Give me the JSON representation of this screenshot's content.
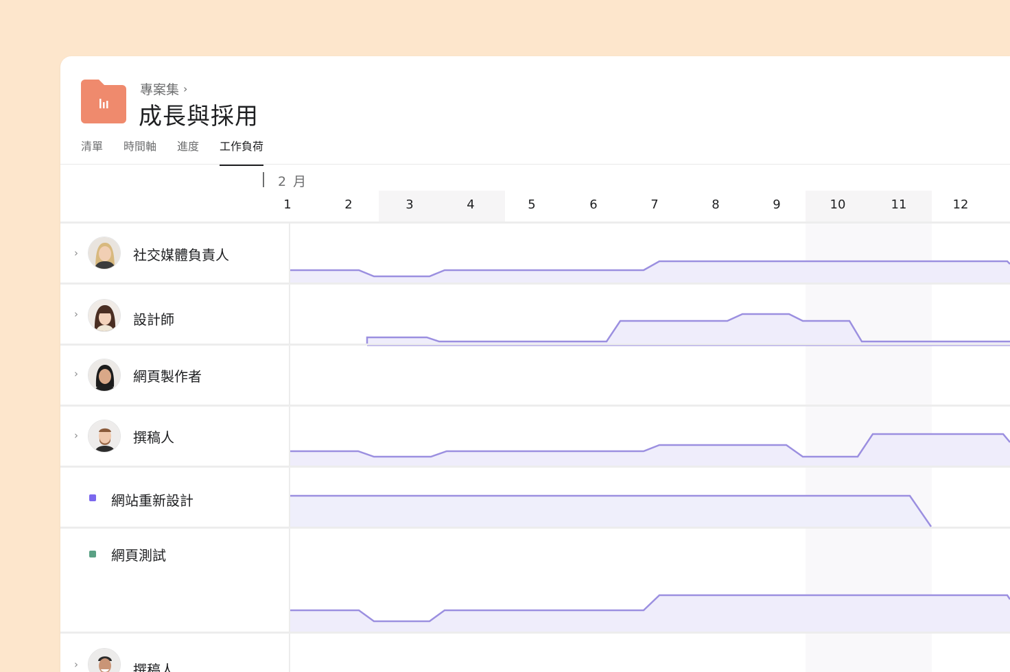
{
  "breadcrumb": {
    "label": "專案集"
  },
  "title": "成長與採用",
  "tabs": [
    {
      "label": "清單",
      "active": false
    },
    {
      "label": "時間軸",
      "active": false
    },
    {
      "label": "進度",
      "active": false
    },
    {
      "label": "工作負荷",
      "active": true
    }
  ],
  "timeline": {
    "month": "2 月",
    "days": [
      "1",
      "2",
      "3",
      "4",
      "5",
      "6",
      "7",
      "8",
      "9",
      "10",
      "11",
      "12"
    ]
  },
  "rows": [
    {
      "type": "person",
      "label": "社交媒體負責人",
      "avatar_icon": "woman-blonde-avatar"
    },
    {
      "type": "person",
      "label": "設計師",
      "avatar_icon": "woman-bangs-avatar"
    },
    {
      "type": "person",
      "label": "網頁製作者",
      "avatar_icon": "woman-dark-hair-avatar"
    },
    {
      "type": "person",
      "label": "撰稿人",
      "avatar_icon": "man-beard-avatar"
    },
    {
      "type": "project",
      "label": "網站重新設計",
      "color": "#7b68ee"
    },
    {
      "type": "project",
      "label": "網頁測試",
      "color": "#5aa184"
    },
    {
      "type": "person",
      "label": "撰稿人",
      "avatar_icon": "man-smiling-avatar"
    }
  ],
  "colors": {
    "accent": "#9b8fe0",
    "fill": "#efedfb",
    "folder": "#ef8a6d",
    "background": "#fde6cc"
  }
}
